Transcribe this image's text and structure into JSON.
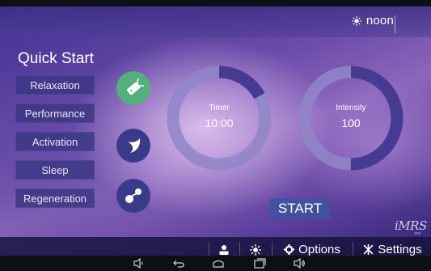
{
  "status_bar": {
    "time": "noon",
    "time_icon": "sun-icon"
  },
  "quick_start": {
    "title": "Quick Start",
    "programs": [
      {
        "label": "Relaxation",
        "icon": "leaf-icon"
      },
      {
        "label": "Performance",
        "icon": "moon-icon"
      },
      {
        "label": "Activation",
        "icon": "atom-icon"
      },
      {
        "label": "Sleep"
      },
      {
        "label": "Regeneration"
      }
    ],
    "active_program_icon_index": 0
  },
  "timer": {
    "caption": "Timer",
    "value": "10:00",
    "progress_fraction": 0.17
  },
  "intensity": {
    "caption": "Intensity",
    "value": "100",
    "progress_fraction": 0.5
  },
  "start_label": "START",
  "logo": {
    "text": "iMRS",
    "sub": "one"
  },
  "bottom_bar": {
    "items": [
      {
        "icon": "user-icon"
      },
      {
        "icon": "brightness-icon"
      },
      {
        "icon": "gear-icon",
        "label": "Options"
      },
      {
        "icon": "tools-icon",
        "label": "Settings"
      }
    ]
  },
  "nav_bar": {
    "buttons": [
      "volume-down-icon",
      "back-icon",
      "home-icon",
      "recents-icon",
      "volume-up-icon"
    ]
  },
  "colors": {
    "active_icon": "#54b07a",
    "idle_icon": "#3a3a8a",
    "button_bg": "#3a3782",
    "dial_track": "#8f86c8",
    "dial_fill": "#463a92"
  }
}
